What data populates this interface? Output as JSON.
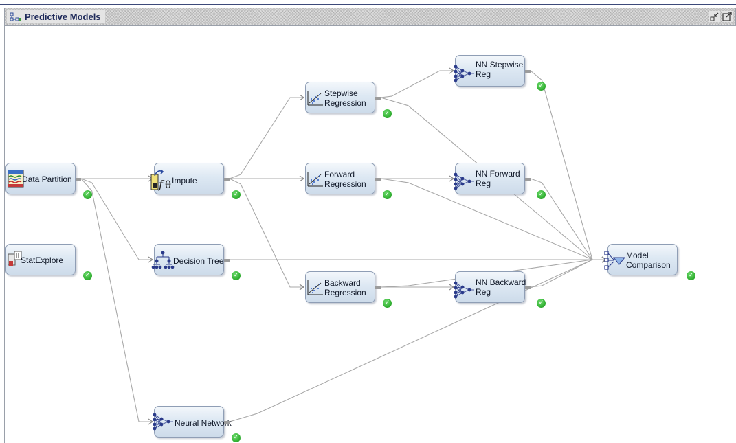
{
  "window": {
    "title": "Predictive Models",
    "icons": [
      "diagram-icon",
      "minimize-icon",
      "maximize-icon"
    ]
  },
  "colors": {
    "node_border": "#8f9eb5",
    "connector": "#a8a8a8",
    "status_ok": "#35b335",
    "title_text": "#1e2a5a"
  },
  "nodes": [
    {
      "id": "data-partition",
      "label": "Data Partition",
      "icon": "data-partition-icon",
      "status": "complete"
    },
    {
      "id": "statexplore",
      "label": "StatExplore",
      "icon": "statexplore-icon",
      "status": "complete"
    },
    {
      "id": "impute",
      "label": "Impute",
      "icon": "impute-icon",
      "status": "complete"
    },
    {
      "id": "decision-tree",
      "label": "Decision Tree",
      "icon": "decision-tree-icon",
      "status": "complete"
    },
    {
      "id": "neural-network",
      "label": "Neural Network",
      "icon": "neural-network-icon",
      "status": "complete"
    },
    {
      "id": "stepwise-regression",
      "label": "Stepwise\nRegression",
      "icon": "regression-icon",
      "status": "complete"
    },
    {
      "id": "forward-regression",
      "label": "Forward\nRegression",
      "icon": "regression-icon",
      "status": "complete"
    },
    {
      "id": "backward-regression",
      "label": "Backward\nRegression",
      "icon": "regression-icon",
      "status": "complete"
    },
    {
      "id": "nn-stepwise-reg",
      "label": "NN Stepwise\nReg",
      "icon": "neural-network-icon",
      "status": "complete"
    },
    {
      "id": "nn-forward-reg",
      "label": "NN Forward\nReg",
      "icon": "neural-network-icon",
      "status": "complete"
    },
    {
      "id": "nn-backward-reg",
      "label": "NN Backward\nReg",
      "icon": "neural-network-icon",
      "status": "complete"
    },
    {
      "id": "model-comparison",
      "label": "Model\nComparison",
      "icon": "model-comparison-icon",
      "status": "complete"
    }
  ],
  "connections": [
    [
      "data-partition",
      "impute"
    ],
    [
      "data-partition",
      "decision-tree"
    ],
    [
      "data-partition",
      "neural-network"
    ],
    [
      "impute",
      "stepwise-regression"
    ],
    [
      "impute",
      "forward-regression"
    ],
    [
      "impute",
      "backward-regression"
    ],
    [
      "stepwise-regression",
      "nn-stepwise-reg"
    ],
    [
      "forward-regression",
      "nn-forward-reg"
    ],
    [
      "backward-regression",
      "nn-backward-reg"
    ],
    [
      "stepwise-regression",
      "model-comparison"
    ],
    [
      "forward-regression",
      "model-comparison"
    ],
    [
      "backward-regression",
      "model-comparison"
    ],
    [
      "nn-stepwise-reg",
      "model-comparison"
    ],
    [
      "nn-forward-reg",
      "model-comparison"
    ],
    [
      "nn-backward-reg",
      "model-comparison"
    ],
    [
      "decision-tree",
      "model-comparison"
    ],
    [
      "neural-network",
      "model-comparison"
    ]
  ]
}
